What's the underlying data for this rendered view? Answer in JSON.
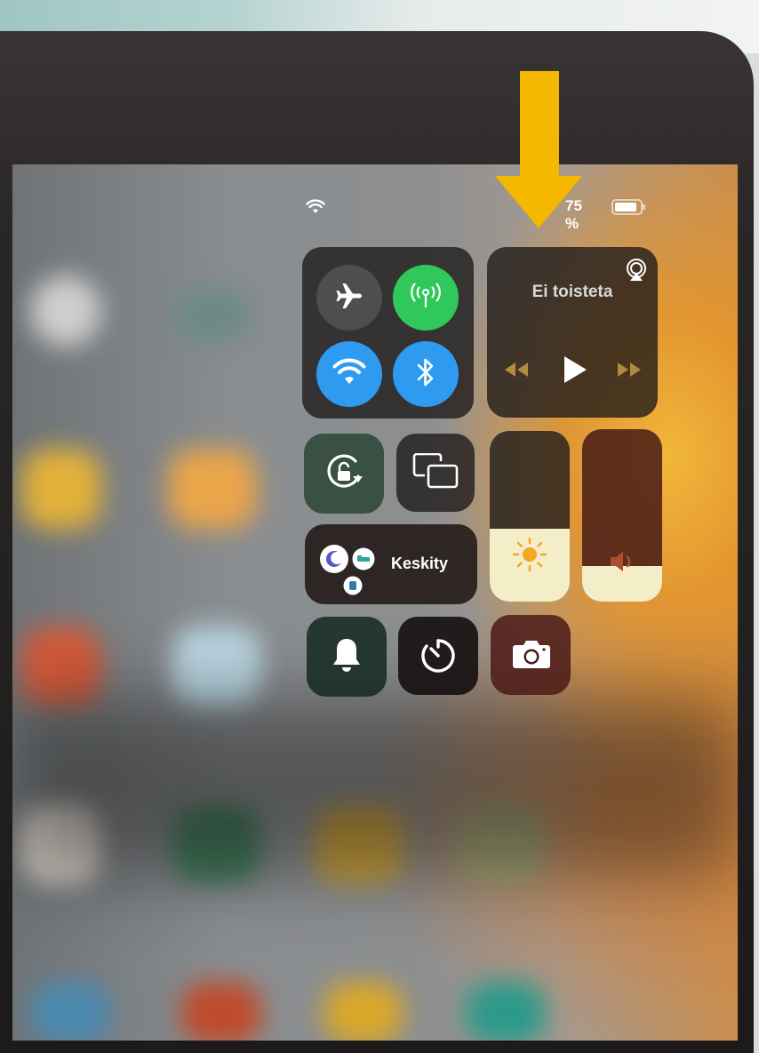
{
  "status_bar": {
    "battery_text": "75 %",
    "battery_level": 0.75,
    "wifi_icon": "wifi-icon"
  },
  "connectivity": {
    "airplane": {
      "icon": "airplane-icon",
      "on": false
    },
    "cellular": {
      "icon": "cellular-icon",
      "on": true,
      "color": "#30c85a"
    },
    "wifi": {
      "icon": "wifi-icon",
      "on": true,
      "color": "#2f9bf0"
    },
    "bluetooth": {
      "icon": "bluetooth-icon",
      "on": true,
      "color": "#2f9bf0"
    }
  },
  "now_playing": {
    "status_text": "Ei toisteta",
    "airplay_icon": "airplay-icon",
    "controls": [
      "rewind-icon",
      "play-icon",
      "fast-forward-icon"
    ]
  },
  "controls": {
    "rotation_lock_icon": "rotation-lock-icon",
    "screen_mirroring_icon": "screen-mirroring-icon",
    "focus_label": "Keskity",
    "focus_icons": [
      "moon-icon",
      "bed-icon",
      "person-icon"
    ],
    "brightness_level": 0.5,
    "volume_level": 0.4,
    "bell_icon": "bell-icon",
    "timer_icon": "timer-icon",
    "camera_icon": "camera-icon"
  },
  "annotation": {
    "arrow_color": "#f5b800",
    "arrow_icon": "down-arrow-icon"
  }
}
